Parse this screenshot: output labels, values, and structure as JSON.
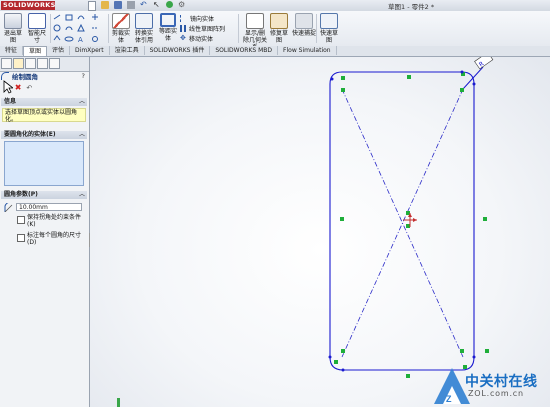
{
  "app": {
    "logo_text": "SOLIDWORKS",
    "document_title": "草图1 - 零件2 *"
  },
  "ribbon": {
    "exit_sketch": "退出草图",
    "smart_dimension": "智能尺寸",
    "trim_entities": "剪裁实体",
    "convert_entities": "转换实体引用",
    "offset_entities": "等距实体",
    "mirror_entities": "镜向实体",
    "linear_pattern": "线性草图阵列",
    "move_entities": "移动实体",
    "display_delete_relations": "显示/删除几何关系",
    "repair_sketch": "修复草图",
    "quick_snaps": "快速捕捉",
    "rapid_sketch": "快速草图"
  },
  "tabs": [
    {
      "label": "特征"
    },
    {
      "label": "草图"
    },
    {
      "label": "评估"
    },
    {
      "label": "DimXpert"
    },
    {
      "label": "渲染工具"
    },
    {
      "label": "SOLIDWORKS 插件"
    },
    {
      "label": "SOLIDWORKS MBD"
    },
    {
      "label": "Flow Simulation"
    }
  ],
  "panel": {
    "title": "绘制圆角",
    "help": "?",
    "message_section": "信息",
    "message_text": "选择草图顶点或实体以圆角化。",
    "entities_section": "要圆角化的实体(E)",
    "params_section": "圆角参数(P)",
    "radius_value": "10.00mm",
    "keep_constrained_corners": "保持拐角处约束条件(K)",
    "dimension_each_fillet": "标注每个圆角的尺寸(D)"
  },
  "watermark": {
    "title": "中关村在线",
    "url": "ZOL.com.cn"
  },
  "colors": {
    "sketch_line": "#1a1ad0",
    "construction_line": "#2a2ac8",
    "relation_marker": "#1fae3a",
    "brand_red": "#b3282e",
    "watermark_blue": "#1a6ec2"
  }
}
